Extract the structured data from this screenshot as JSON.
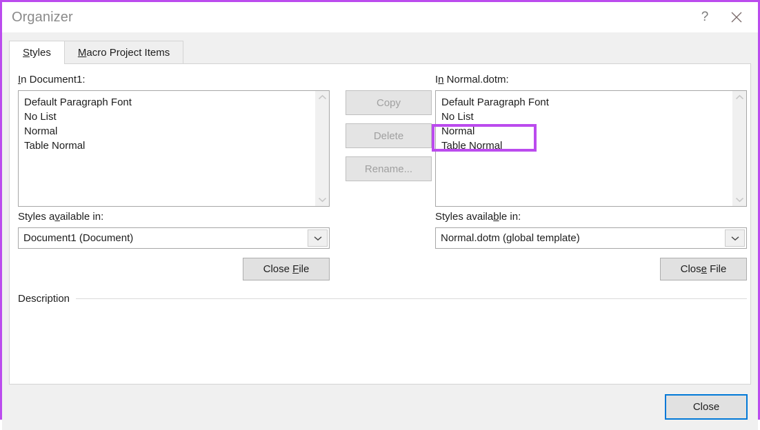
{
  "window": {
    "title": "Organizer",
    "border_color": "#bb4bee",
    "help_icon": "question-mark-icon",
    "close_icon": "close-x-icon"
  },
  "tabs": [
    {
      "label": "Styles",
      "accel": "S",
      "active": true
    },
    {
      "label": "Macro Project Items",
      "accel": "M",
      "active": false
    }
  ],
  "left": {
    "list_label": "In Document1:",
    "list_label_accel": "I",
    "items": [
      "Default Paragraph Font",
      "No List",
      "Normal",
      "Table Normal"
    ],
    "available_label": "Styles available in:",
    "available_accel": "v",
    "combo_value": "Document1 (Document)",
    "close_file_label": "Close File",
    "close_file_accel": "F"
  },
  "right": {
    "list_label": "In Normal.dotm:",
    "list_label_accel": "n",
    "highlighted": true,
    "highlight_color": "#bb4bee",
    "items": [
      "Default Paragraph Font",
      "No List",
      "Normal",
      "Table Normal"
    ],
    "available_label": "Styles available in:",
    "available_accel": "b",
    "combo_value": "Normal.dotm (global template)",
    "close_file_label": "Close File",
    "close_file_accel": "e"
  },
  "middle_buttons": [
    {
      "label": "Copy",
      "enabled": false
    },
    {
      "label": "Delete",
      "enabled": false
    },
    {
      "label": "Rename...",
      "enabled": false
    }
  ],
  "description": {
    "label": "Description",
    "text": ""
  },
  "footer": {
    "close_label": "Close",
    "focus_color": "#0078d7"
  },
  "scrollbar": {
    "up_icon": "chevron-up-icon",
    "down_icon": "chevron-down-icon"
  },
  "combo_arrow_icon": "chevron-down-icon"
}
